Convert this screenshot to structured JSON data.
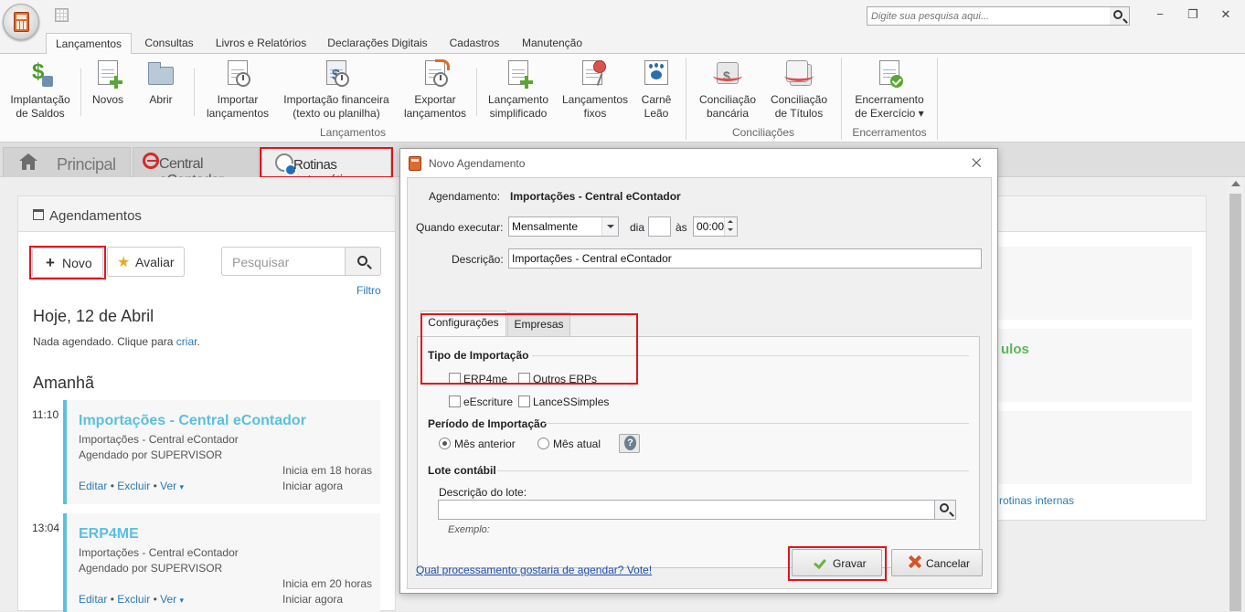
{
  "titlebar": {
    "search_placeholder": "Digite sua pesquisa aqui...",
    "minimize": "−",
    "restore": "❐",
    "close": "✕"
  },
  "ribbon": {
    "tabs": [
      "Lançamentos",
      "Consultas",
      "Livros e Relatórios",
      "Declarações Digitais",
      "Cadastros",
      "Manutenção"
    ],
    "active_tab": "Lançamentos",
    "buttons": {
      "implantacao": [
        "Implantação",
        "de Saldos"
      ],
      "novos": [
        "Novos"
      ],
      "abrir": [
        "Abrir"
      ],
      "importar": [
        "Importar",
        "lançamentos"
      ],
      "importacao_fin": [
        "Importação financeira",
        "(texto ou planilha)"
      ],
      "exportar": [
        "Exportar",
        "lançamentos"
      ],
      "simplificado": [
        "Lançamento",
        "simplificado"
      ],
      "fixos": [
        "Lançamentos",
        "fixos"
      ],
      "carne": [
        "Carnê",
        "Leão"
      ],
      "conc_bancaria": [
        "Conciliação",
        "bancária"
      ],
      "conc_titulos": [
        "Conciliação",
        "de Títulos"
      ],
      "encerramento": [
        "Encerramento",
        "de Exercício ▾"
      ]
    },
    "groups": {
      "lancamentos": "Lançamentos",
      "conciliacoes": "Conciliações",
      "encerramentos": "Encerramentos"
    }
  },
  "page_tabs": {
    "principal": "Principal",
    "econtador": "Central eContador",
    "rotinas": "Rotinas automáticas"
  },
  "agenda": {
    "title": "Agendamentos",
    "novo_label": "Novo",
    "avaliar_label": "Avaliar",
    "search_placeholder": "Pesquisar",
    "filtro": "Filtro",
    "today_heading": "Hoje, 12 de Abril",
    "nothing_text": "Nada agendado. Clique para",
    "criar_link": "criar",
    "nothing_period": ".",
    "tomorrow_heading": "Amanhã",
    "events": [
      {
        "time": "11:10",
        "title": "Importações - Central eContador",
        "subtitle": "Importações - Central eContador",
        "scheduled_by": "Agendado por SUPERVISOR",
        "starts_in": "Inicia em 18 horas",
        "start_now": "Iniciar agora",
        "actions": {
          "edit": "Editar",
          "delete": "Excluir",
          "view": "Ver"
        }
      },
      {
        "time": "13:04",
        "title": "ERP4ME",
        "subtitle": "Importações - Central eContador",
        "scheduled_by": "Agendado por SUPERVISOR",
        "starts_in": "Inicia em 20 horas",
        "start_now": "Iniciar agora",
        "actions": {
          "edit": "Editar",
          "delete": "Excluir",
          "view": "Ver"
        }
      }
    ]
  },
  "right_panel": {
    "partial_title": "ulos",
    "partial_link": "rotinas internas"
  },
  "dialog": {
    "title": "Novo Agendamento",
    "close": "⨉",
    "agendamento_label": "Agendamento:",
    "agendamento_value": "Importações - Central eContador",
    "quando_label": "Quando executar:",
    "quando_value": "Mensalmente",
    "dia_label": "dia",
    "dia_value": "",
    "as_label": "às",
    "hora_value": "00:00",
    "descricao_label": "Descrição:",
    "descricao_value": "Importações - Central eContador",
    "tabs": {
      "config": "Configurações",
      "empresas": "Empresas"
    },
    "tipo_title": "Tipo de Importação",
    "tipos": [
      "ERP4me",
      "Outros ERPs",
      "eEscriture",
      "LanceSSimples"
    ],
    "periodo_title": "Período de Importação",
    "periodos": [
      "Mês anterior",
      "Mês atual"
    ],
    "periodo_selected": "Mês anterior",
    "lote_title": "Lote contábil",
    "lote_desc_label": "Descrição do lote:",
    "lote_desc_value": "",
    "exemplo_label": "Exemplo:",
    "vote_link": "Qual processamento gostaria de agendar? Vote!",
    "gravar": "Gravar",
    "cancelar": "Cancelar"
  }
}
